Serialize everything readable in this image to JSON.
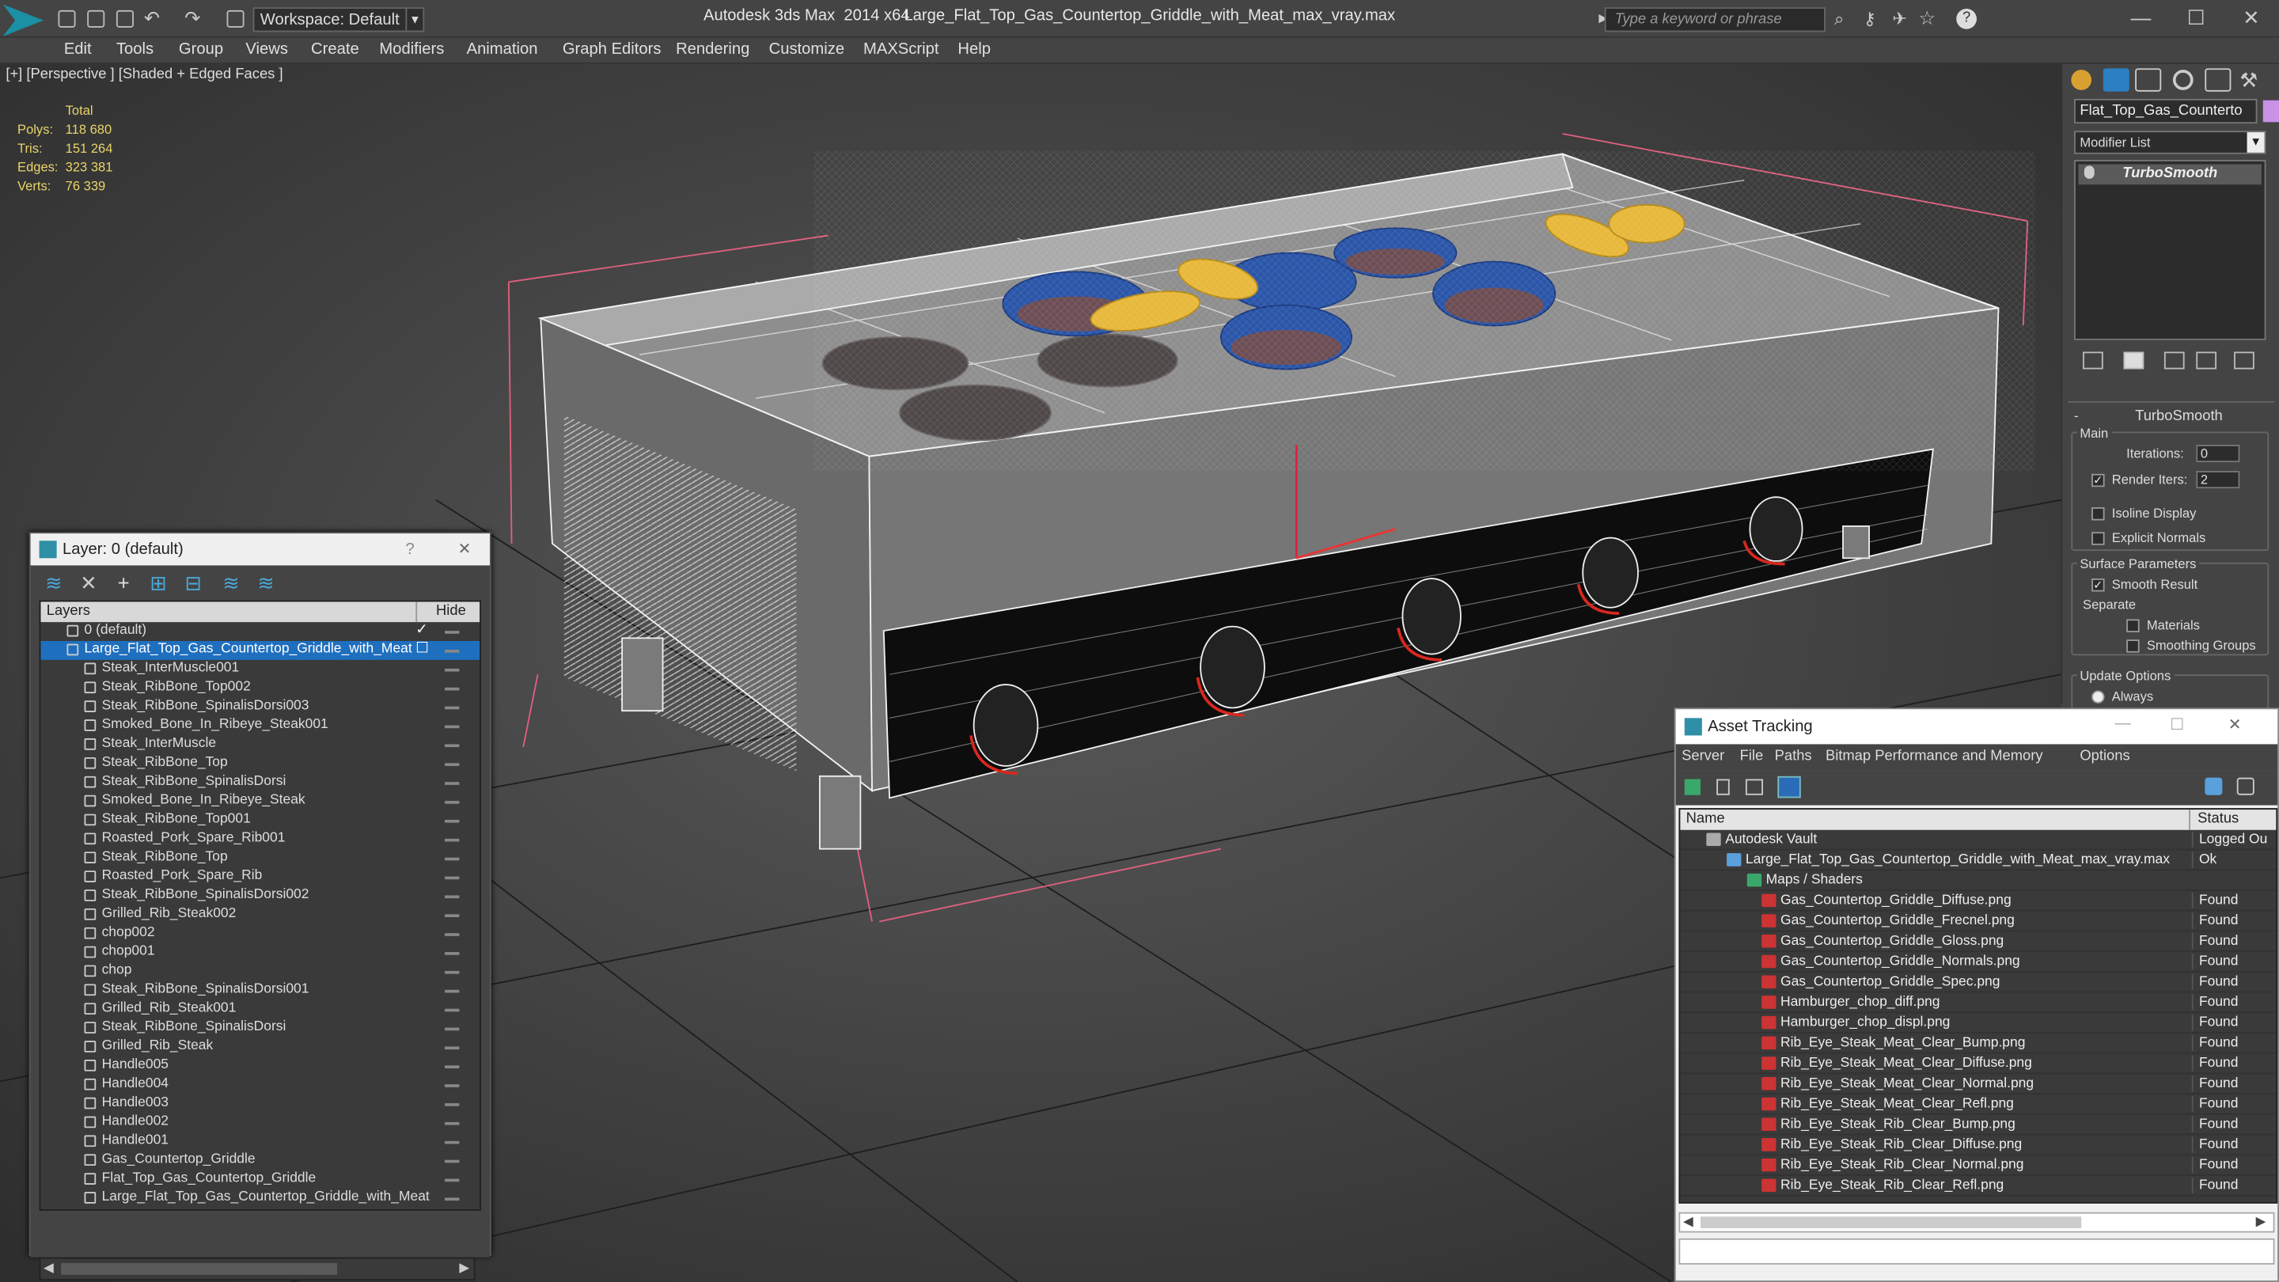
{
  "titlebar": {
    "workspace": "Workspace: Default",
    "app_title": "Autodesk 3ds Max  2014 x64",
    "file_title": "Large_Flat_Top_Gas_Countertop_Griddle_with_Meat_max_vray.max",
    "search_placeholder": "Type a keyword or phrase",
    "minimize": "—",
    "maximize": "☐",
    "close": "✕"
  },
  "menu": [
    "Edit",
    "Tools",
    "Group",
    "Views",
    "Create",
    "Modifiers",
    "Animation",
    "Graph Editors",
    "Rendering",
    "Customize",
    "MAXScript",
    "Help"
  ],
  "viewport": {
    "label": "[+] [Perspective ] [Shaded + Edged Faces ]",
    "stats_header": "Total",
    "stats": [
      {
        "k": "Polys:",
        "v": "118 680"
      },
      {
        "k": "Tris:",
        "v": "151 264"
      },
      {
        "k": "Edges:",
        "v": "323 381"
      },
      {
        "k": "Verts:",
        "v": "76 339"
      }
    ]
  },
  "command_panel": {
    "object_name": "Flat_Top_Gas_Counterto",
    "object_color": "#c992e6",
    "modifier_list": "Modifier List",
    "stack_item": "TurboSmooth",
    "rollout_title": "TurboSmooth",
    "main": "Main",
    "iterations_label": "Iterations:",
    "iterations": "0",
    "render_iters_label": "Render Iters:",
    "render_iters": "2",
    "isoline": "Isoline Display",
    "explicit": "Explicit Normals",
    "surface": "Surface Parameters",
    "smooth_result": "Smooth Result",
    "separate": "Separate",
    "materials": "Materials",
    "smoothing_groups": "Smoothing Groups",
    "update_options": "Update Options",
    "always": "Always"
  },
  "layers": {
    "title": "Layer: 0 (default)",
    "help": "?",
    "close": "✕",
    "col_layers": "Layers",
    "col_hide": "Hide",
    "rows": [
      "0 (default)",
      "Large_Flat_Top_Gas_Countertop_Griddle_with_Meat",
      "Steak_InterMuscle001",
      "Steak_RibBone_Top002",
      "Steak_RibBone_SpinalisDorsi003",
      "Smoked_Bone_In_Ribeye_Steak001",
      "Steak_InterMuscle",
      "Steak_RibBone_Top",
      "Steak_RibBone_SpinalisDorsi",
      "Smoked_Bone_In_Ribeye_Steak",
      "Steak_RibBone_Top001",
      "Roasted_Pork_Spare_Rib001",
      "Steak_RibBone_Top",
      "Roasted_Pork_Spare_Rib",
      "Steak_RibBone_SpinalisDorsi002",
      "Grilled_Rib_Steak002",
      "chop002",
      "chop001",
      "chop",
      "Steak_RibBone_SpinalisDorsi001",
      "Grilled_Rib_Steak001",
      "Steak_RibBone_SpinalisDorsi",
      "Grilled_Rib_Steak",
      "Handle005",
      "Handle004",
      "Handle003",
      "Handle002",
      "Handle001",
      "Gas_Countertop_Griddle",
      "Flat_Top_Gas_Countertop_Griddle",
      "Large_Flat_Top_Gas_Countertop_Griddle_with_Meat"
    ]
  },
  "assets": {
    "title": "Asset Tracking",
    "menu": [
      "Server",
      "File",
      "Paths",
      "Bitmap Performance and Memory",
      "Options"
    ],
    "col_name": "Name",
    "col_status": "Status",
    "rows": [
      {
        "name": "Autodesk Vault",
        "status": "Logged Ou"
      },
      {
        "name": "Large_Flat_Top_Gas_Countertop_Griddle_with_Meat_max_vray.max",
        "status": "Ok"
      },
      {
        "name": "Maps / Shaders",
        "status": ""
      },
      {
        "name": "Gas_Countertop_Griddle_Diffuse.png",
        "status": "Found"
      },
      {
        "name": "Gas_Countertop_Griddle_Frecnel.png",
        "status": "Found"
      },
      {
        "name": "Gas_Countertop_Griddle_Gloss.png",
        "status": "Found"
      },
      {
        "name": "Gas_Countertop_Griddle_Normals.png",
        "status": "Found"
      },
      {
        "name": "Gas_Countertop_Griddle_Spec.png",
        "status": "Found"
      },
      {
        "name": "Hamburger_chop_diff.png",
        "status": "Found"
      },
      {
        "name": "Hamburger_chop_displ.png",
        "status": "Found"
      },
      {
        "name": "Rib_Eye_Steak_Meat_Clear_Bump.png",
        "status": "Found"
      },
      {
        "name": "Rib_Eye_Steak_Meat_Clear_Diffuse.png",
        "status": "Found"
      },
      {
        "name": "Rib_Eye_Steak_Meat_Clear_Normal.png",
        "status": "Found"
      },
      {
        "name": "Rib_Eye_Steak_Meat_Clear_Refl.png",
        "status": "Found"
      },
      {
        "name": "Rib_Eye_Steak_Rib_Clear_Bump.png",
        "status": "Found"
      },
      {
        "name": "Rib_Eye_Steak_Rib_Clear_Diffuse.png",
        "status": "Found"
      },
      {
        "name": "Rib_Eye_Steak_Rib_Clear_Normal.png",
        "status": "Found"
      },
      {
        "name": "Rib_Eye_Steak_Rib_Clear_Refl.png",
        "status": "Found"
      }
    ]
  }
}
